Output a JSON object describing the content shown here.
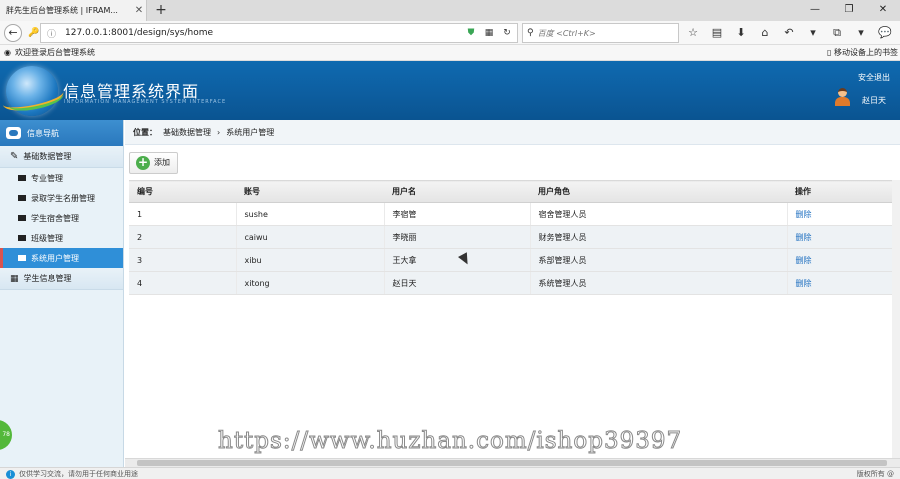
{
  "browser": {
    "tab_title": "胖先生后台管理系统 | IFRAM...",
    "url": "127.0.0.1:8001/design/sys/home",
    "search_placeholder": "百度 <Ctrl+K>",
    "bookmark_left": "欢迎登录后台管理系统",
    "bookmark_right": "移动设备上的书签"
  },
  "header": {
    "title": "信息管理系统界面",
    "subtitle": "INFORMATION MANAGEMENT SYSTEM INTERFACE",
    "logout": "安全退出",
    "username": "赵日天",
    "brand_color": "#0e6ab0"
  },
  "sidebar": {
    "title": "信息导航",
    "groups": [
      {
        "label": "基础数据管理",
        "items": [
          {
            "label": "专业管理"
          },
          {
            "label": "录取学生名册管理"
          },
          {
            "label": "学生宿舍管理"
          },
          {
            "label": "班级管理"
          },
          {
            "label": "系统用户管理",
            "active": true
          }
        ]
      },
      {
        "label": "学生信息管理"
      }
    ]
  },
  "breadcrumb": {
    "prefix": "位置：",
    "level1": "基础数据管理",
    "separator": "›",
    "level2": "系统用户管理"
  },
  "toolbar": {
    "add_label": "添加"
  },
  "table": {
    "headers": [
      "编号",
      "账号",
      "用户名",
      "用户角色",
      "操作"
    ],
    "rows": [
      {
        "id": "1",
        "account": "sushe",
        "name": "李宿管",
        "role": "宿舍管理人员",
        "action": "删除"
      },
      {
        "id": "2",
        "account": "caiwu",
        "name": "李晓丽",
        "role": "财务管理人员",
        "action": "删除"
      },
      {
        "id": "3",
        "account": "xibu",
        "name": "王大拿",
        "role": "系部管理人员",
        "action": "删除"
      },
      {
        "id": "4",
        "account": "xitong",
        "name": "赵日天",
        "role": "系统管理人员",
        "action": "删除"
      }
    ]
  },
  "statusbar": {
    "left": "仅供学习交流，请勿用于任何商业用途",
    "right": "版权所有 @"
  },
  "float_badge": "78",
  "watermark": "https://www.huzhan.com/ishop39397"
}
